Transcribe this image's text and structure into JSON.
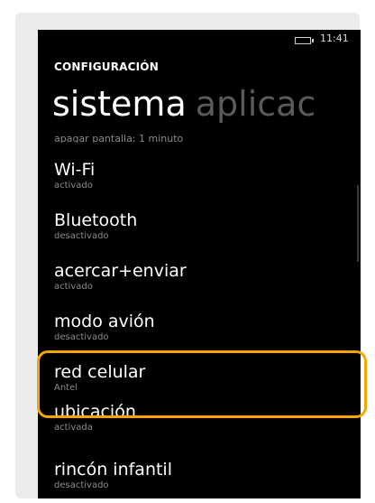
{
  "status_bar": {
    "time": "11:41",
    "battery_icon": "battery-icon"
  },
  "header": {
    "app_title": "CONFIGURACIÓN"
  },
  "pivot": {
    "active": "sistema",
    "next": "aplicac"
  },
  "list": {
    "clipped_sub": "apagar pantalla: 1 minuto",
    "items": [
      {
        "label": "Wi-Fi",
        "sub": "activado"
      },
      {
        "label": "Bluetooth",
        "sub": "desactivado"
      },
      {
        "label": "acercar+enviar",
        "sub": "activado"
      },
      {
        "label": "modo avión",
        "sub": "desactivado"
      },
      {
        "label": "red celular",
        "sub": "Antel"
      },
      {
        "label": "ubicación",
        "sub": "activada"
      },
      {
        "label": "rincón infantil",
        "sub": "desactivado"
      }
    ]
  },
  "colors": {
    "background": "#000000",
    "highlight": "#f7a600",
    "subtext": "#8c8c8c",
    "inactive_pivot": "#5a5a5a"
  }
}
